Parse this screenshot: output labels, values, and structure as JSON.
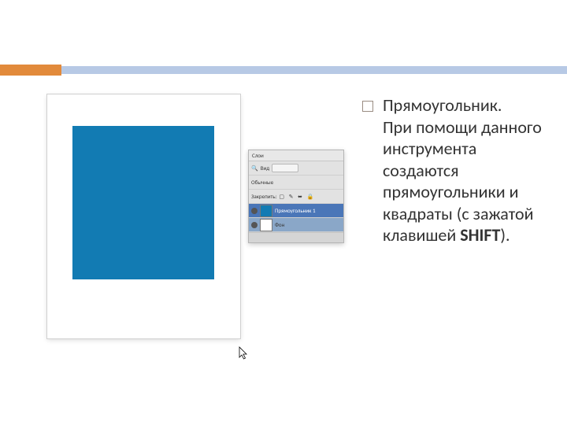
{
  "panel": {
    "tab": "Слои",
    "view_label": "Вид",
    "view_icon": "🔍",
    "blend_mode": "Обычные",
    "lock_label": "Закрепить:",
    "lock_icons": "▢ ✎ ⬌ 🔒",
    "layers": [
      {
        "name": "Прямоугольник 1",
        "thumb": "blue",
        "selected": true
      },
      {
        "name": "Фон",
        "thumb": "white",
        "selected": false
      }
    ]
  },
  "text": {
    "title": "Прямоугольник.",
    "body_1": "При помощи данного инструмента создаются прямоугольники и квадраты (с зажатой клавишей ",
    "body_bold": "SHIFT",
    "body_2": ")."
  }
}
